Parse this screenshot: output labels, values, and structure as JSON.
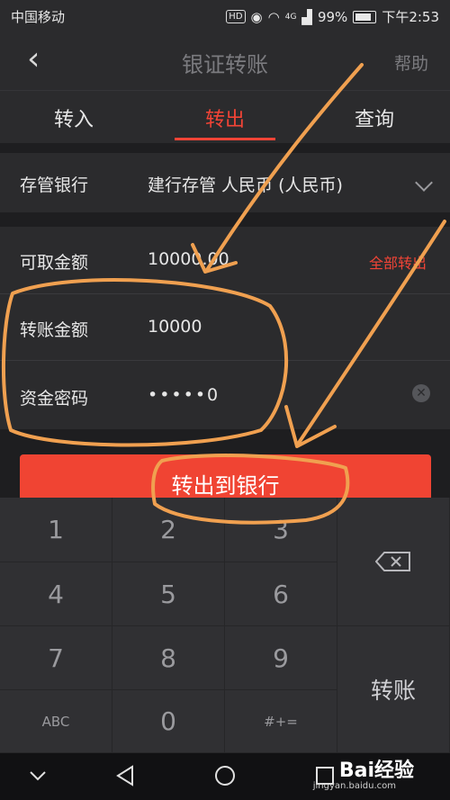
{
  "status": {
    "carrier": "中国移动",
    "hd": "HD",
    "network": "4G",
    "battery": "99%",
    "time": "下午2:53"
  },
  "header": {
    "back_icon": "chevron-left-icon",
    "title": "银证转账",
    "help": "帮助"
  },
  "tabs": [
    {
      "label": "转入"
    },
    {
      "label": "转出",
      "active": true
    },
    {
      "label": "查询"
    }
  ],
  "form": {
    "bank": {
      "label": "存管银行",
      "value": "建行存管 人民币 (人民币)"
    },
    "available": {
      "label": "可取金额",
      "value": "10000.00",
      "action": "全部转出"
    },
    "amount": {
      "label": "转账金额",
      "value": "10000"
    },
    "password": {
      "label": "资金密码",
      "value": "•••••0"
    }
  },
  "submit_label": "转出到银行",
  "keypad": {
    "keys": [
      "1",
      "2",
      "3",
      "4",
      "5",
      "6",
      "7",
      "8",
      "9",
      "ABC",
      "0",
      "#+="
    ],
    "backspace_icon": "backspace-icon",
    "transfer": "转账"
  },
  "nav": {
    "icons": [
      "chevron-down-icon",
      "back-triangle-icon",
      "home-circle-icon",
      "recents-square-icon"
    ]
  },
  "watermark": {
    "brand": "Bai经验",
    "url": "jingyan.baidu.com"
  },
  "colors": {
    "accent": "#f24436",
    "annotation": "#f0a050",
    "background": "#1e1e20"
  }
}
